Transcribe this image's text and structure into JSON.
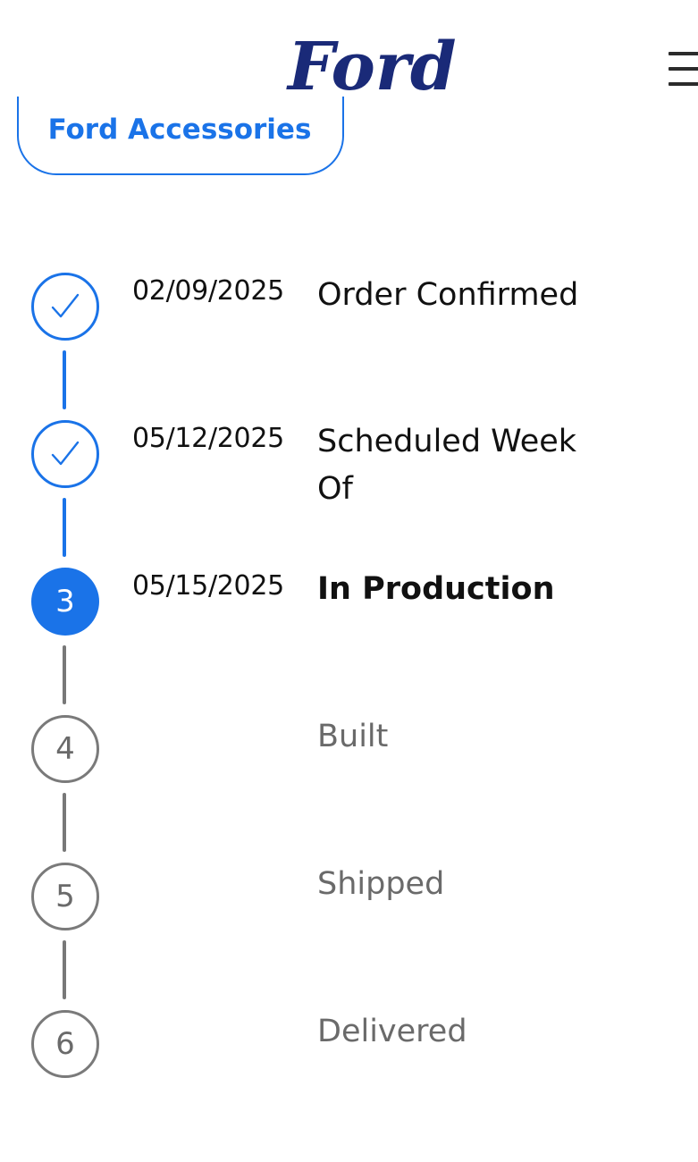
{
  "header": {
    "logo_text": "Ford",
    "menu_icon": "hamburger-menu-icon",
    "accessories_label": "Ford Accessories"
  },
  "colors": {
    "brand_navy": "#1a2a78",
    "accent_blue": "#1a73e8",
    "pending_gray": "#7a7a7a"
  },
  "steps": [
    {
      "number": "1",
      "status": "completed",
      "date": "02/09/2025",
      "label": "Order Confirmed",
      "icon": "checkmark-icon"
    },
    {
      "number": "2",
      "status": "completed",
      "date": "05/12/2025",
      "label": "Scheduled Week Of",
      "icon": "checkmark-icon"
    },
    {
      "number": "3",
      "status": "current",
      "date": "05/15/2025",
      "label": "In Production"
    },
    {
      "number": "4",
      "status": "pending",
      "date": "",
      "label": "Built"
    },
    {
      "number": "5",
      "status": "pending",
      "date": "",
      "label": "Shipped"
    },
    {
      "number": "6",
      "status": "pending",
      "date": "",
      "label": "Delivered"
    }
  ]
}
